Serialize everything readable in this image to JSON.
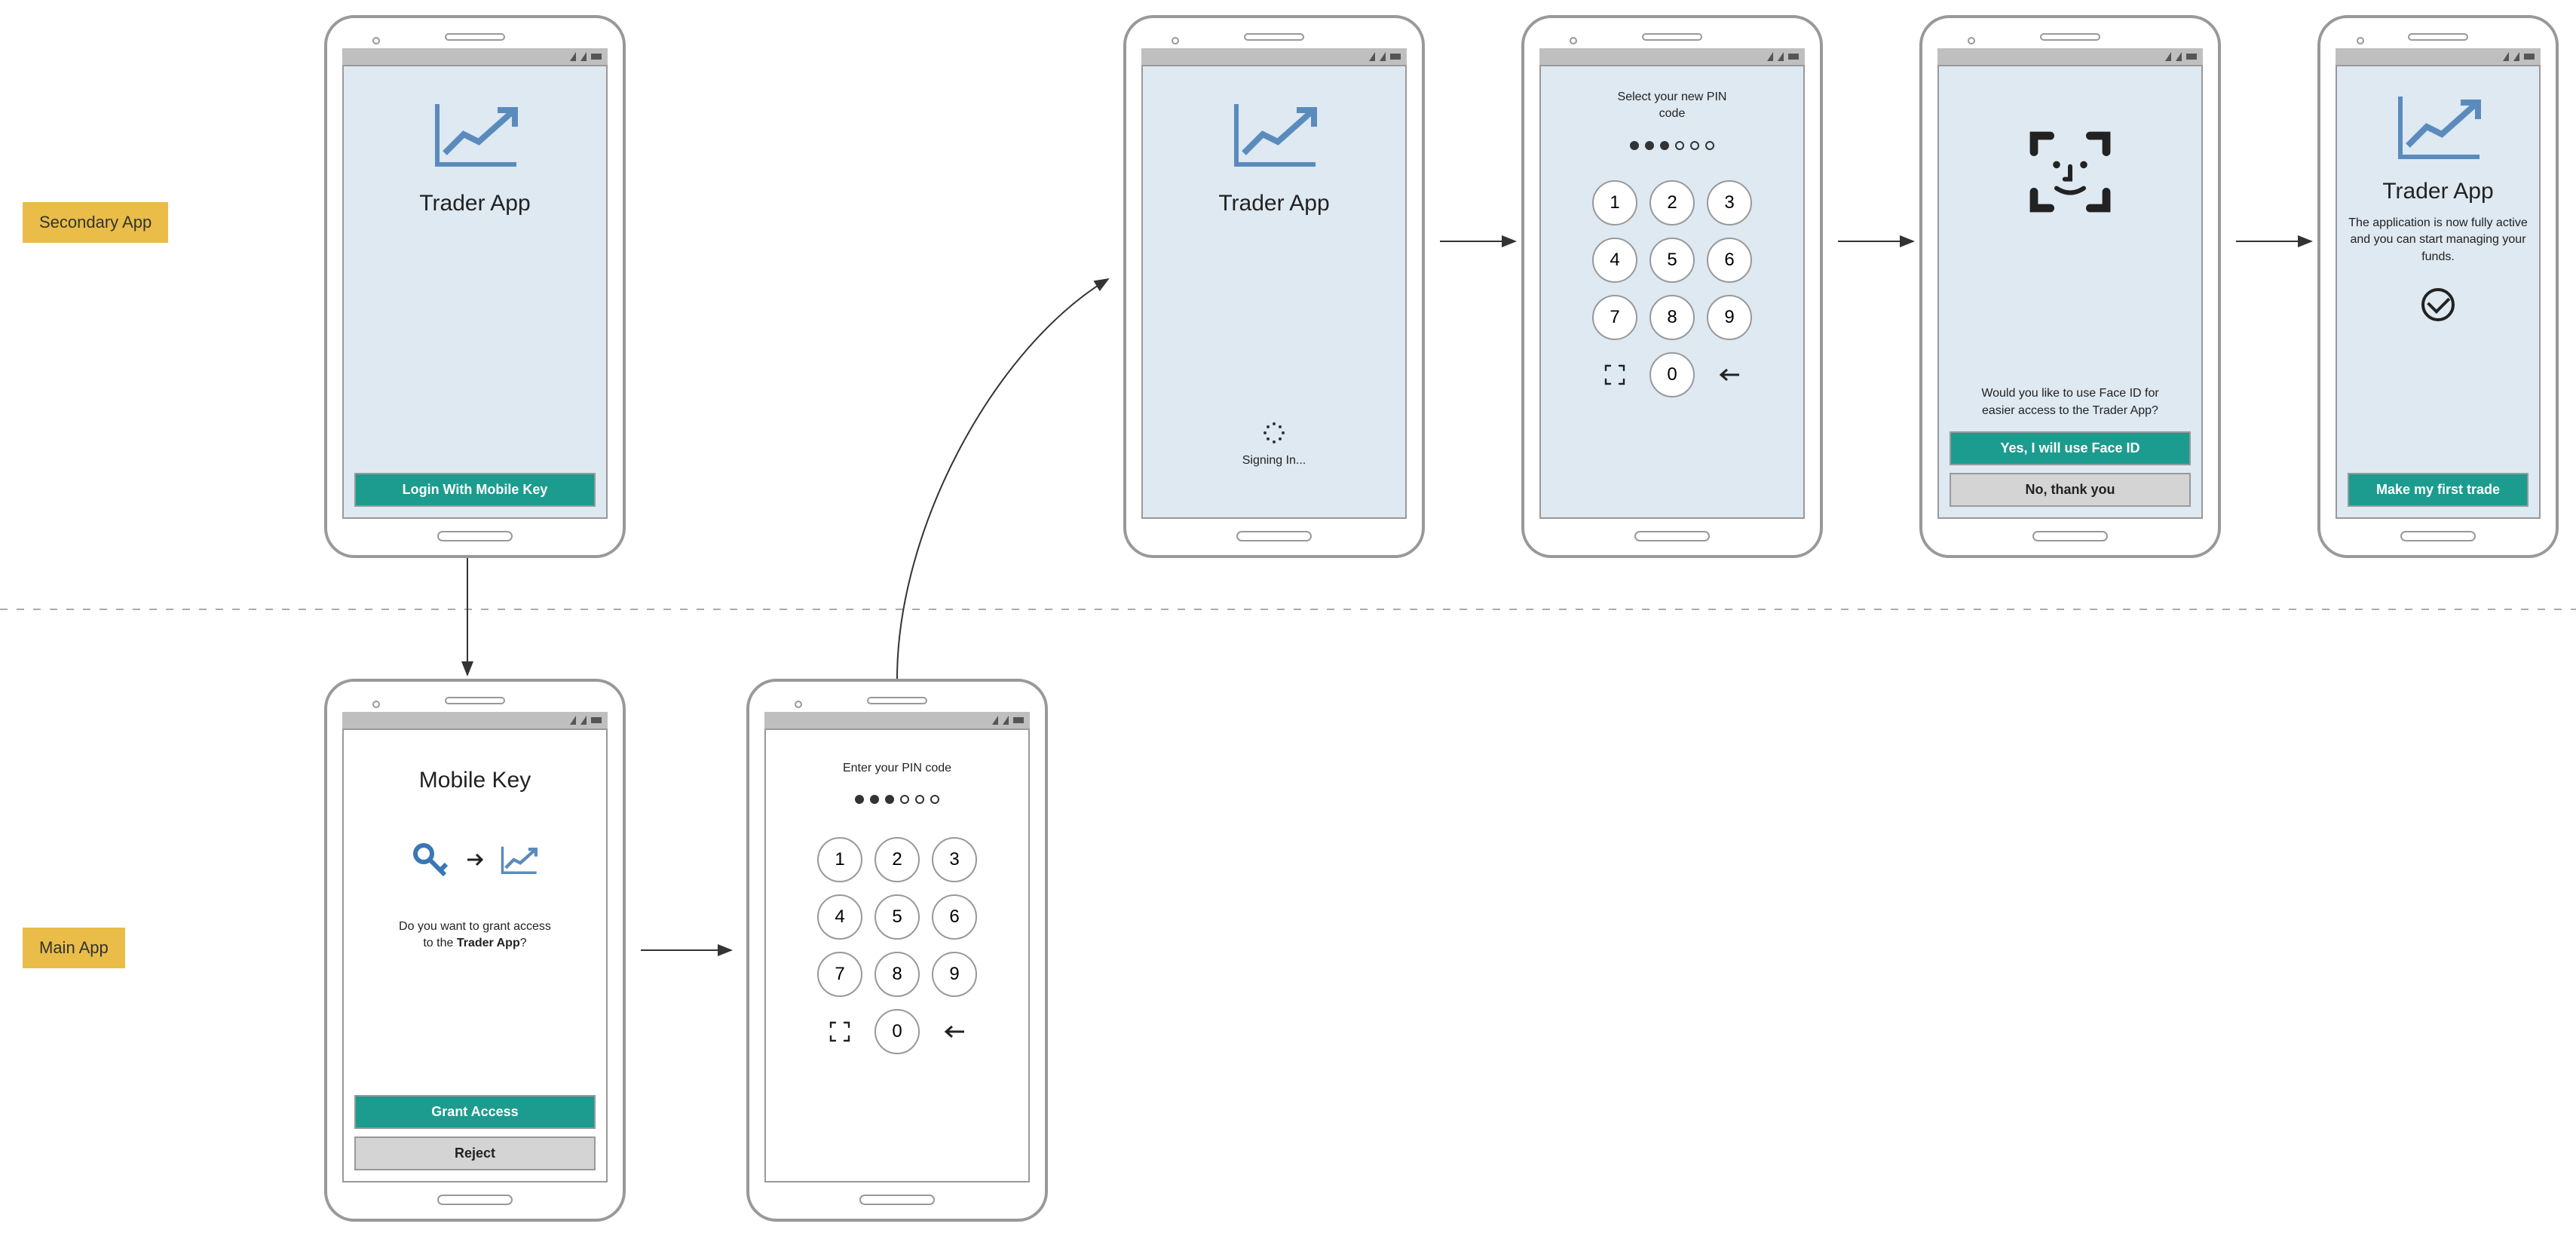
{
  "labels": {
    "secondary_app": "Secondary App",
    "main_app": "Main App"
  },
  "screens": {
    "s1": {
      "title": "Trader App",
      "login_btn": "Login With Mobile Key"
    },
    "s2": {
      "title": "Trader App",
      "status": "Signing In..."
    },
    "s3": {
      "prompt": "Select your new PIN code",
      "filled_dots": 3,
      "total_dots": 6,
      "keys": [
        "1",
        "2",
        "3",
        "4",
        "5",
        "6",
        "7",
        "8",
        "9"
      ],
      "zero": "0"
    },
    "s4": {
      "prompt": "Would you like to use Face ID for easier access to the Trader App?",
      "yes_btn": "Yes, I will use Face ID",
      "no_btn": "No, thank you"
    },
    "s5": {
      "title": "Trader App",
      "desc": "The application is now fully active and you can start managing your funds.",
      "cta": "Make my first trade"
    },
    "m1": {
      "title": "Mobile Key",
      "prompt_line1": "Do you want to grant access",
      "prompt_line2_prefix": "to the ",
      "prompt_line2_bold": "Trader App",
      "prompt_line2_suffix": "?",
      "grant_btn": "Grant Access",
      "reject_btn": "Reject"
    },
    "m2": {
      "prompt": "Enter your PIN code",
      "filled_dots": 3,
      "total_dots": 6,
      "keys": [
        "1",
        "2",
        "3",
        "4",
        "5",
        "6",
        "7",
        "8",
        "9"
      ],
      "zero": "0"
    }
  }
}
